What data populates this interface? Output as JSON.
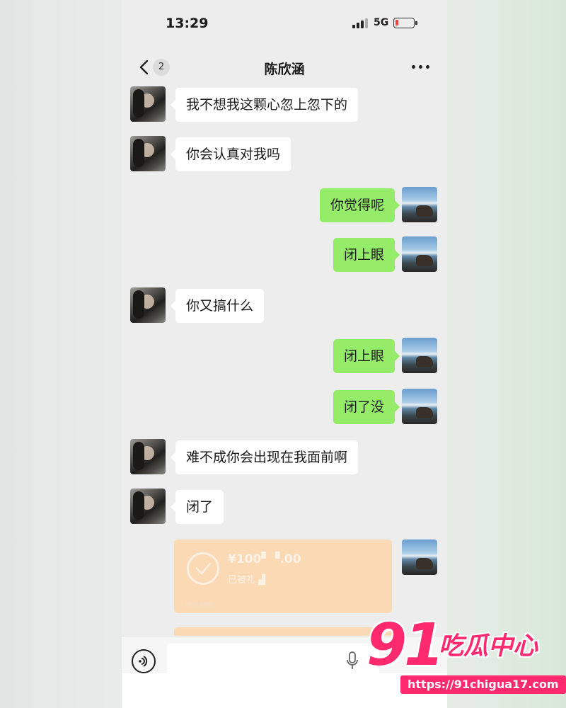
{
  "status_bar": {
    "time": "13:29",
    "network": "5G"
  },
  "nav": {
    "unread_count": "2",
    "title": "陈欣涵"
  },
  "messages": [
    {
      "side": "left",
      "text": "我不想我这颗心忽上忽下的"
    },
    {
      "side": "left",
      "text": "你会认真对我吗"
    },
    {
      "side": "right",
      "text": "你觉得呢"
    },
    {
      "side": "right",
      "text": "闭上眼"
    },
    {
      "side": "left",
      "text": "你又搞什么"
    },
    {
      "side": "right",
      "text": "闭上眼"
    },
    {
      "side": "right",
      "text": "闭了没"
    },
    {
      "side": "left",
      "text": "难不成你会出现在我面前啊"
    },
    {
      "side": "left",
      "text": "闭了"
    }
  ],
  "transfer": {
    "amount": "¥100▘▝.00",
    "status": "已被礼 ▟",
    "footer": "微信转账"
  },
  "input": {
    "placeholder": ""
  },
  "watermark": {
    "number": "91",
    "name": "吃瓜中心",
    "url": "https://91chigua17.com"
  },
  "colors": {
    "bubble_self": "#95ec69",
    "bubble_other": "#ffffff",
    "transfer": "#fad9b4",
    "watermark": "#ff2a6d"
  }
}
